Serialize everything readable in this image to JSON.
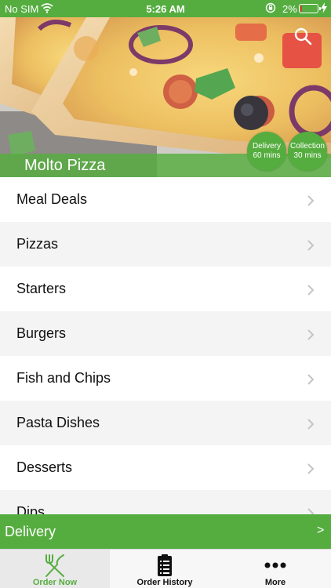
{
  "status_bar": {
    "carrier": "No SIM",
    "time": "5:26 AM",
    "battery": "2%"
  },
  "hero": {
    "restaurant_name": "Molto Pizza",
    "delivery_badge": {
      "line1": "Delivery",
      "line2": "60 mins"
    },
    "collection_badge": {
      "line1": "Collection",
      "line2": "30 mins"
    },
    "search_icon": "search-icon"
  },
  "menu": {
    "items": [
      {
        "label": "Meal Deals"
      },
      {
        "label": "Pizzas"
      },
      {
        "label": "Starters"
      },
      {
        "label": "Burgers"
      },
      {
        "label": "Fish and Chips"
      },
      {
        "label": "Pasta Dishes"
      },
      {
        "label": "Desserts"
      },
      {
        "label": "Dips"
      }
    ]
  },
  "delivery_bar": {
    "label": "Delivery",
    "arrow": ">"
  },
  "tabs": [
    {
      "label": "Order Now",
      "icon": "fork-knife-icon",
      "active": true
    },
    {
      "label": "Order History",
      "icon": "clipboard-icon",
      "active": false
    },
    {
      "label": "More",
      "icon": "more-dots-icon",
      "active": false
    }
  ],
  "colors": {
    "accent": "#55ad3f",
    "text": "#111111",
    "row_alt": "#f4f4f4"
  }
}
